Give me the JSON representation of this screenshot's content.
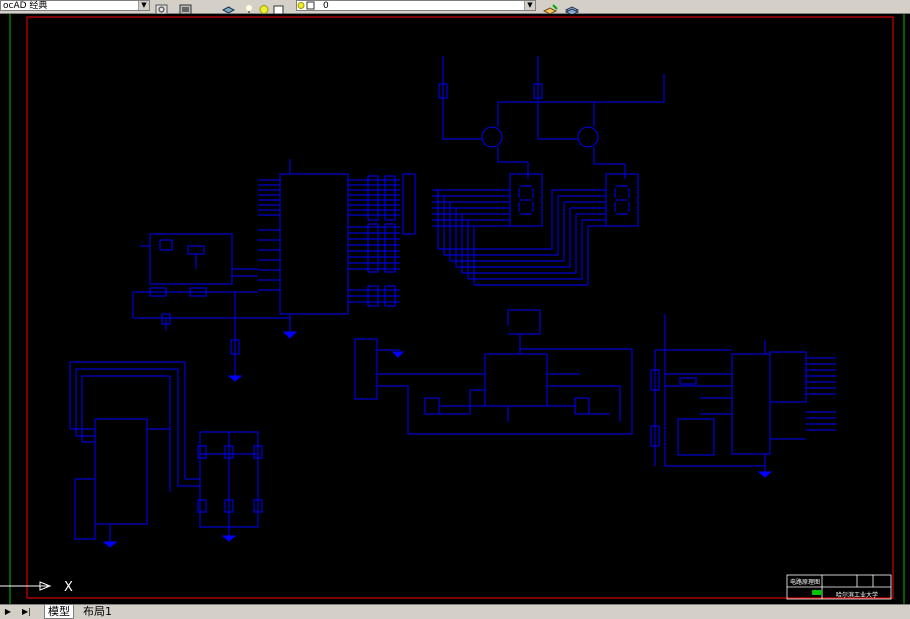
{
  "toolbar": {
    "style_combo": "ocAD 经典",
    "layer_combo": "0"
  },
  "ucs": {
    "x_label": "X"
  },
  "tabs": [
    {
      "label": "模型"
    },
    {
      "label": "布局1"
    }
  ],
  "title_block": {
    "name": "电路原理图",
    "school": "哈尔滨工业大学"
  },
  "colors": {
    "canvas": "#000000",
    "wire": "#0000ff",
    "border": "#ff0000",
    "drawing_edge": "#00ff00"
  },
  "icons": [
    "gear-icon",
    "stack-icon",
    "bulb-icon",
    "sun-icon",
    "layer-icon",
    "layers-icon"
  ]
}
